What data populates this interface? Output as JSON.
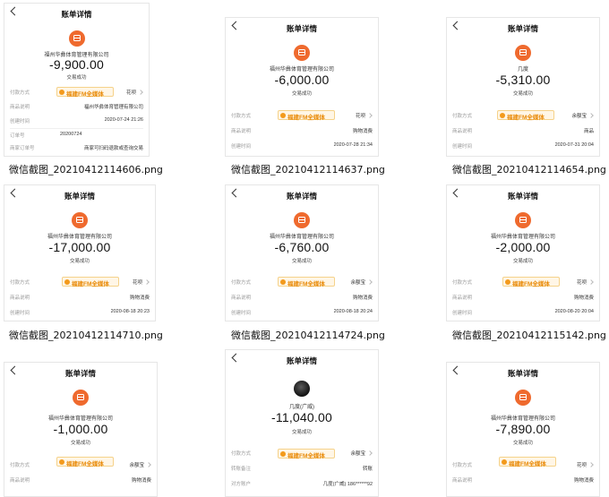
{
  "common": {
    "page_title": "账单详情",
    "status": "交易成功",
    "pay_method_label": "付款方式",
    "goods_label": "商品说明",
    "created_label": "创建时间",
    "order_label": "订单号",
    "merchant_order_label": "商家订单号",
    "remark_label": "转账备注",
    "counterparty_label": "对方账户",
    "promo_text": "福建FM全媒体"
  },
  "thumbs": [
    {
      "caption": "微信截图_20210412114606.png",
      "merchant": "福州华彝体育管理有限公司",
      "amount": "-9,900.00",
      "pay_method": "花呗",
      "goods": "福州华彝体育管理有限公司",
      "created": "2020-07-24 21:26",
      "order_no": "20200724",
      "merchant_order": "商家可扫码退款或查询交易"
    },
    {
      "caption": "微信截图_20210412114637.png",
      "merchant": "福州华彝体育管理有限公司",
      "amount": "-6,000.00",
      "pay_method": "花呗",
      "goods": "购物消费",
      "created": "2020-07-28 21:34"
    },
    {
      "caption": "微信截图_20210412114654.png",
      "merchant": "几度",
      "amount": "-5,310.00",
      "pay_method": "余额宝",
      "goods": "商品",
      "created": "2020-07-31 20:04"
    },
    {
      "caption": "微信截图_20210412114710.png",
      "merchant": "福州华彝体育管理有限公司",
      "amount": "-17,000.00",
      "pay_method": "花呗",
      "goods": "购物消费",
      "created": "2020-08-18 20:23"
    },
    {
      "caption": "微信截图_20210412114724.png",
      "merchant": "福州华彝体育管理有限公司",
      "amount": "-6,760.00",
      "pay_method": "余额宝",
      "goods": "购物消费",
      "created": "2020-08-18 20:24"
    },
    {
      "caption": "微信截图_20210412115142.png",
      "merchant": "福州华彝体育管理有限公司",
      "amount": "-2,000.00",
      "pay_method": "花呗",
      "goods": "购物消费",
      "created": "2020-08-20 20:04"
    },
    {
      "merchant": "福州华彝体育管理有限公司",
      "amount": "-1,000.00",
      "pay_method": "余额宝",
      "goods": "购物消费"
    },
    {
      "merchant": "几度(广威)",
      "amount": "-11,040.00",
      "pay_method": "余额宝",
      "remark": "转账",
      "counterparty": "几度(广威) 186******92"
    },
    {
      "merchant": "福州华彝体育管理有限公司",
      "amount": "-7,890.00",
      "pay_method": "花呗",
      "goods": "购物消费"
    }
  ]
}
